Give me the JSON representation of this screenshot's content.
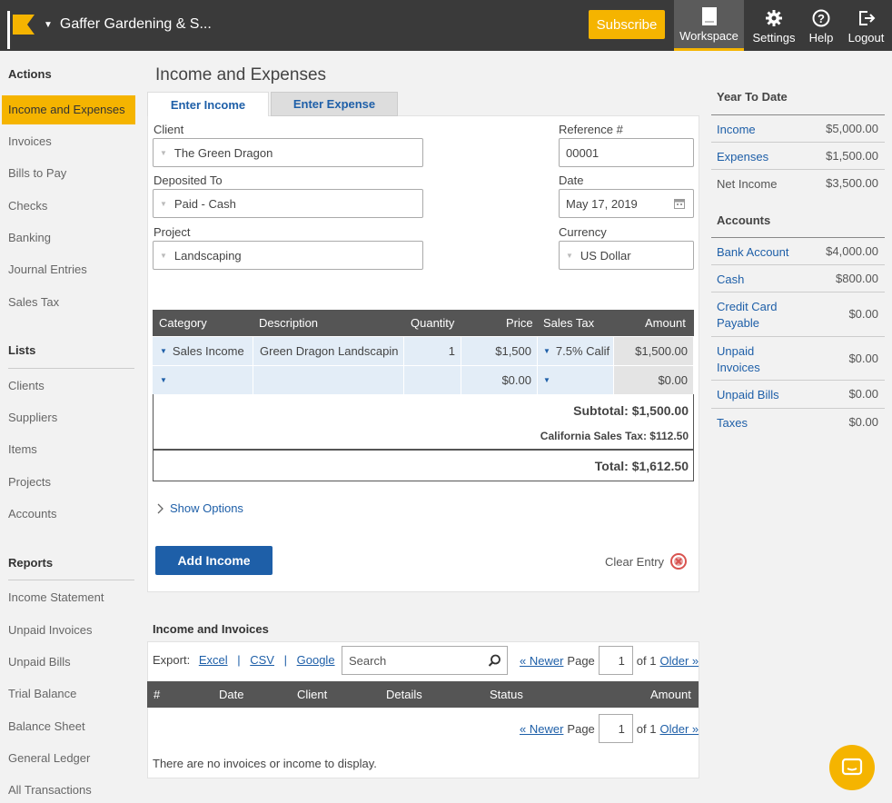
{
  "header": {
    "company": "Gaffer Gardening & S...",
    "subscribe_label": "Subscribe",
    "nav": [
      {
        "label": "Workspace",
        "icon": "workspace-icon"
      },
      {
        "label": "Settings",
        "icon": "gear-icon"
      },
      {
        "label": "Help",
        "icon": "help-icon"
      },
      {
        "label": "Logout",
        "icon": "logout-icon"
      }
    ]
  },
  "sidebar": {
    "actions_heading": "Actions",
    "actions": [
      "Income and Expenses",
      "Invoices",
      "Bills to Pay",
      "Checks",
      "Banking",
      "Journal Entries",
      "Sales Tax"
    ],
    "lists_heading": "Lists",
    "lists": [
      "Clients",
      "Suppliers",
      "Items",
      "Projects",
      "Accounts"
    ],
    "reports_heading": "Reports",
    "reports": [
      "Income Statement",
      "Unpaid Invoices",
      "Unpaid Bills",
      "Trial Balance",
      "Balance Sheet",
      "General Ledger",
      "All Transactions"
    ]
  },
  "main": {
    "title": "Income and Expenses",
    "tabs": [
      "Enter Income",
      "Enter Expense"
    ],
    "form": {
      "client_label": "Client",
      "client_value": "The Green Dragon",
      "deposited_label": "Deposited To",
      "deposited_value": "Paid - Cash",
      "project_label": "Project",
      "project_value": "Landscaping",
      "reference_label": "Reference #",
      "reference_value": "00001",
      "date_label": "Date",
      "date_value": "May 17, 2019",
      "currency_label": "Currency",
      "currency_value": "US Dollar"
    },
    "line_items": {
      "headers": [
        "Category",
        "Description",
        "Quantity",
        "Price",
        "Sales Tax",
        "Amount"
      ],
      "rows": [
        {
          "category": "Sales Income",
          "description": "Green Dragon Landscapin",
          "quantity": "1",
          "price": "$1,500",
          "tax": "7.5% Calif",
          "amount": "$1,500.00"
        },
        {
          "category": "",
          "description": "",
          "quantity": "",
          "price": "$0.00",
          "tax": "",
          "amount": "$0.00"
        }
      ],
      "subtotal": "Subtotal: $1,500.00",
      "sales_tax": "California Sales Tax: $112.50",
      "total": "Total: $1,612.50"
    },
    "show_options": "Show Options",
    "add_income": "Add Income",
    "clear_entry": "Clear Entry",
    "invoices": {
      "title": "Income and Invoices",
      "export_label": "Export:",
      "export_links": [
        "Excel",
        "CSV",
        "Google"
      ],
      "search_placeholder": "Search",
      "newer": "« Newer",
      "page_label": "Page",
      "page_value": "1",
      "of_label": "of 1",
      "older": "Older »",
      "headers": [
        "#",
        "Date",
        "Client",
        "Details",
        "Status",
        "Amount"
      ],
      "empty": "There are no invoices or income to display."
    }
  },
  "right": {
    "ytd_heading": "Year To Date",
    "ytd": [
      {
        "name": "Income",
        "value": "$5,000.00"
      },
      {
        "name": "Expenses",
        "value": "$1,500.00"
      },
      {
        "name": "Net Income",
        "value": "$3,500.00"
      }
    ],
    "accounts_heading": "Accounts",
    "accounts": [
      {
        "name": "Bank Account",
        "value": "$4,000.00"
      },
      {
        "name": "Cash",
        "value": "$800.00"
      },
      {
        "name": "Credit Card Payable",
        "value": "$0.00"
      },
      {
        "name": "Unpaid Invoices",
        "value": "$0.00"
      },
      {
        "name": "Unpaid Bills",
        "value": "$0.00"
      },
      {
        "name": "Taxes",
        "value": "$0.00"
      }
    ]
  },
  "colors": {
    "accent": "#f5b400",
    "link": "#1e5fa8",
    "topbar": "#3a3a3a"
  }
}
